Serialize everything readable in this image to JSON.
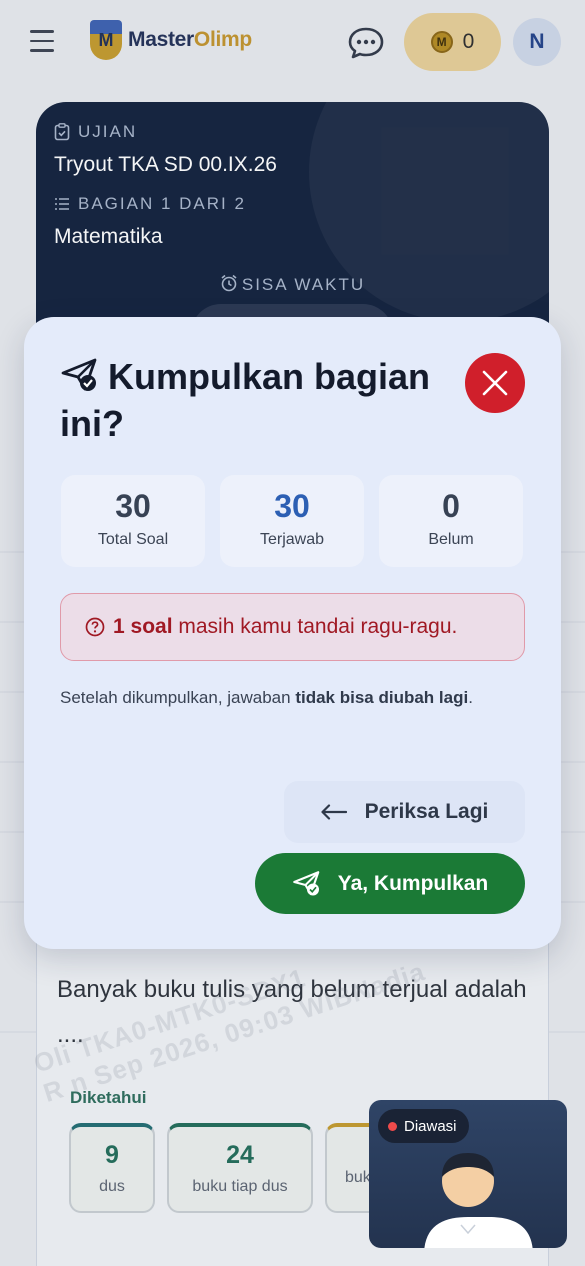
{
  "header": {
    "logo_text_a": "Master",
    "logo_text_b": "Olimp",
    "coin_count": "0",
    "avatar_initial": "N"
  },
  "exam": {
    "exam_label": "UJIAN",
    "exam_name": "Tryout TKA SD 00.IX.26",
    "section_label": "BAGIAN 1 DARI 2",
    "section_name": "Matematika",
    "timer_label": "SISA WAKTU"
  },
  "question": {
    "text": "Banyak buku tulis yang belum terjual adalah ....",
    "known_label": "Diketahui",
    "known": [
      {
        "value": "9",
        "caption": "dus"
      },
      {
        "value": "24",
        "caption": "buku tiap dus"
      },
      {
        "value": "",
        "caption": "buk"
      }
    ],
    "watermark_line1": "Oli   TKA0-MTK0-SDX1",
    "watermark_line2": "R       n   Sep 2026, 09:03 WIBNadia"
  },
  "camera": {
    "badge": "Diawasi"
  },
  "modal": {
    "title": "Kumpulkan bagian ini?",
    "stats": [
      {
        "value": "30",
        "label": "Total Soal",
        "color": "#374254"
      },
      {
        "value": "30",
        "label": "Terjawab",
        "color": "#2c5fb3"
      },
      {
        "value": "0",
        "label": "Belum",
        "color": "#374254"
      }
    ],
    "warning_bold": "1 soal",
    "warning_rest": " masih kamu tandai ragu-ragu.",
    "note_prefix": "Setelah dikumpulkan, jawaban ",
    "note_bold": "tidak bisa diubah lagi",
    "note_suffix": ".",
    "review_label": "Periksa Lagi",
    "submit_label": "Ya, Kumpulkan"
  },
  "colors": {
    "accent_green": "#1b7a36",
    "close_red": "#d01f2b",
    "navy": "#0f1e3a"
  },
  "icons": [
    "menu-icon",
    "chat-icon",
    "coin-icon",
    "clipboard-icon",
    "list-icon",
    "alarm-clock-icon",
    "send-check-icon",
    "close-icon",
    "question-circle-icon",
    "arrow-left-icon"
  ]
}
